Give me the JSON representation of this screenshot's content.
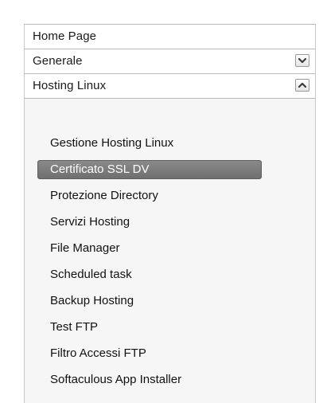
{
  "menu": {
    "sections": [
      {
        "label": "Home Page"
      },
      {
        "label": "Generale",
        "toggle": "expand-chevron-down-icon"
      },
      {
        "label": "Hosting Linux",
        "toggle": "collapse-chevron-up-icon"
      }
    ],
    "hosting_linux_items": [
      {
        "label": "Gestione Hosting Linux"
      },
      {
        "label": "Certificato SSL DV",
        "active": true
      },
      {
        "label": "Protezione Directory"
      },
      {
        "label": "Servizi Hosting"
      },
      {
        "label": "File Manager"
      },
      {
        "label": "Scheduled task"
      },
      {
        "label": "Backup Hosting"
      },
      {
        "label": "Test FTP"
      },
      {
        "label": "Filtro Accessi FTP"
      },
      {
        "label": "Softaculous App Installer"
      }
    ]
  },
  "colors": {
    "active_item_bg": "#7c7c7c",
    "panel_bg": "#f6f6f6",
    "border": "#b9b9b9"
  }
}
